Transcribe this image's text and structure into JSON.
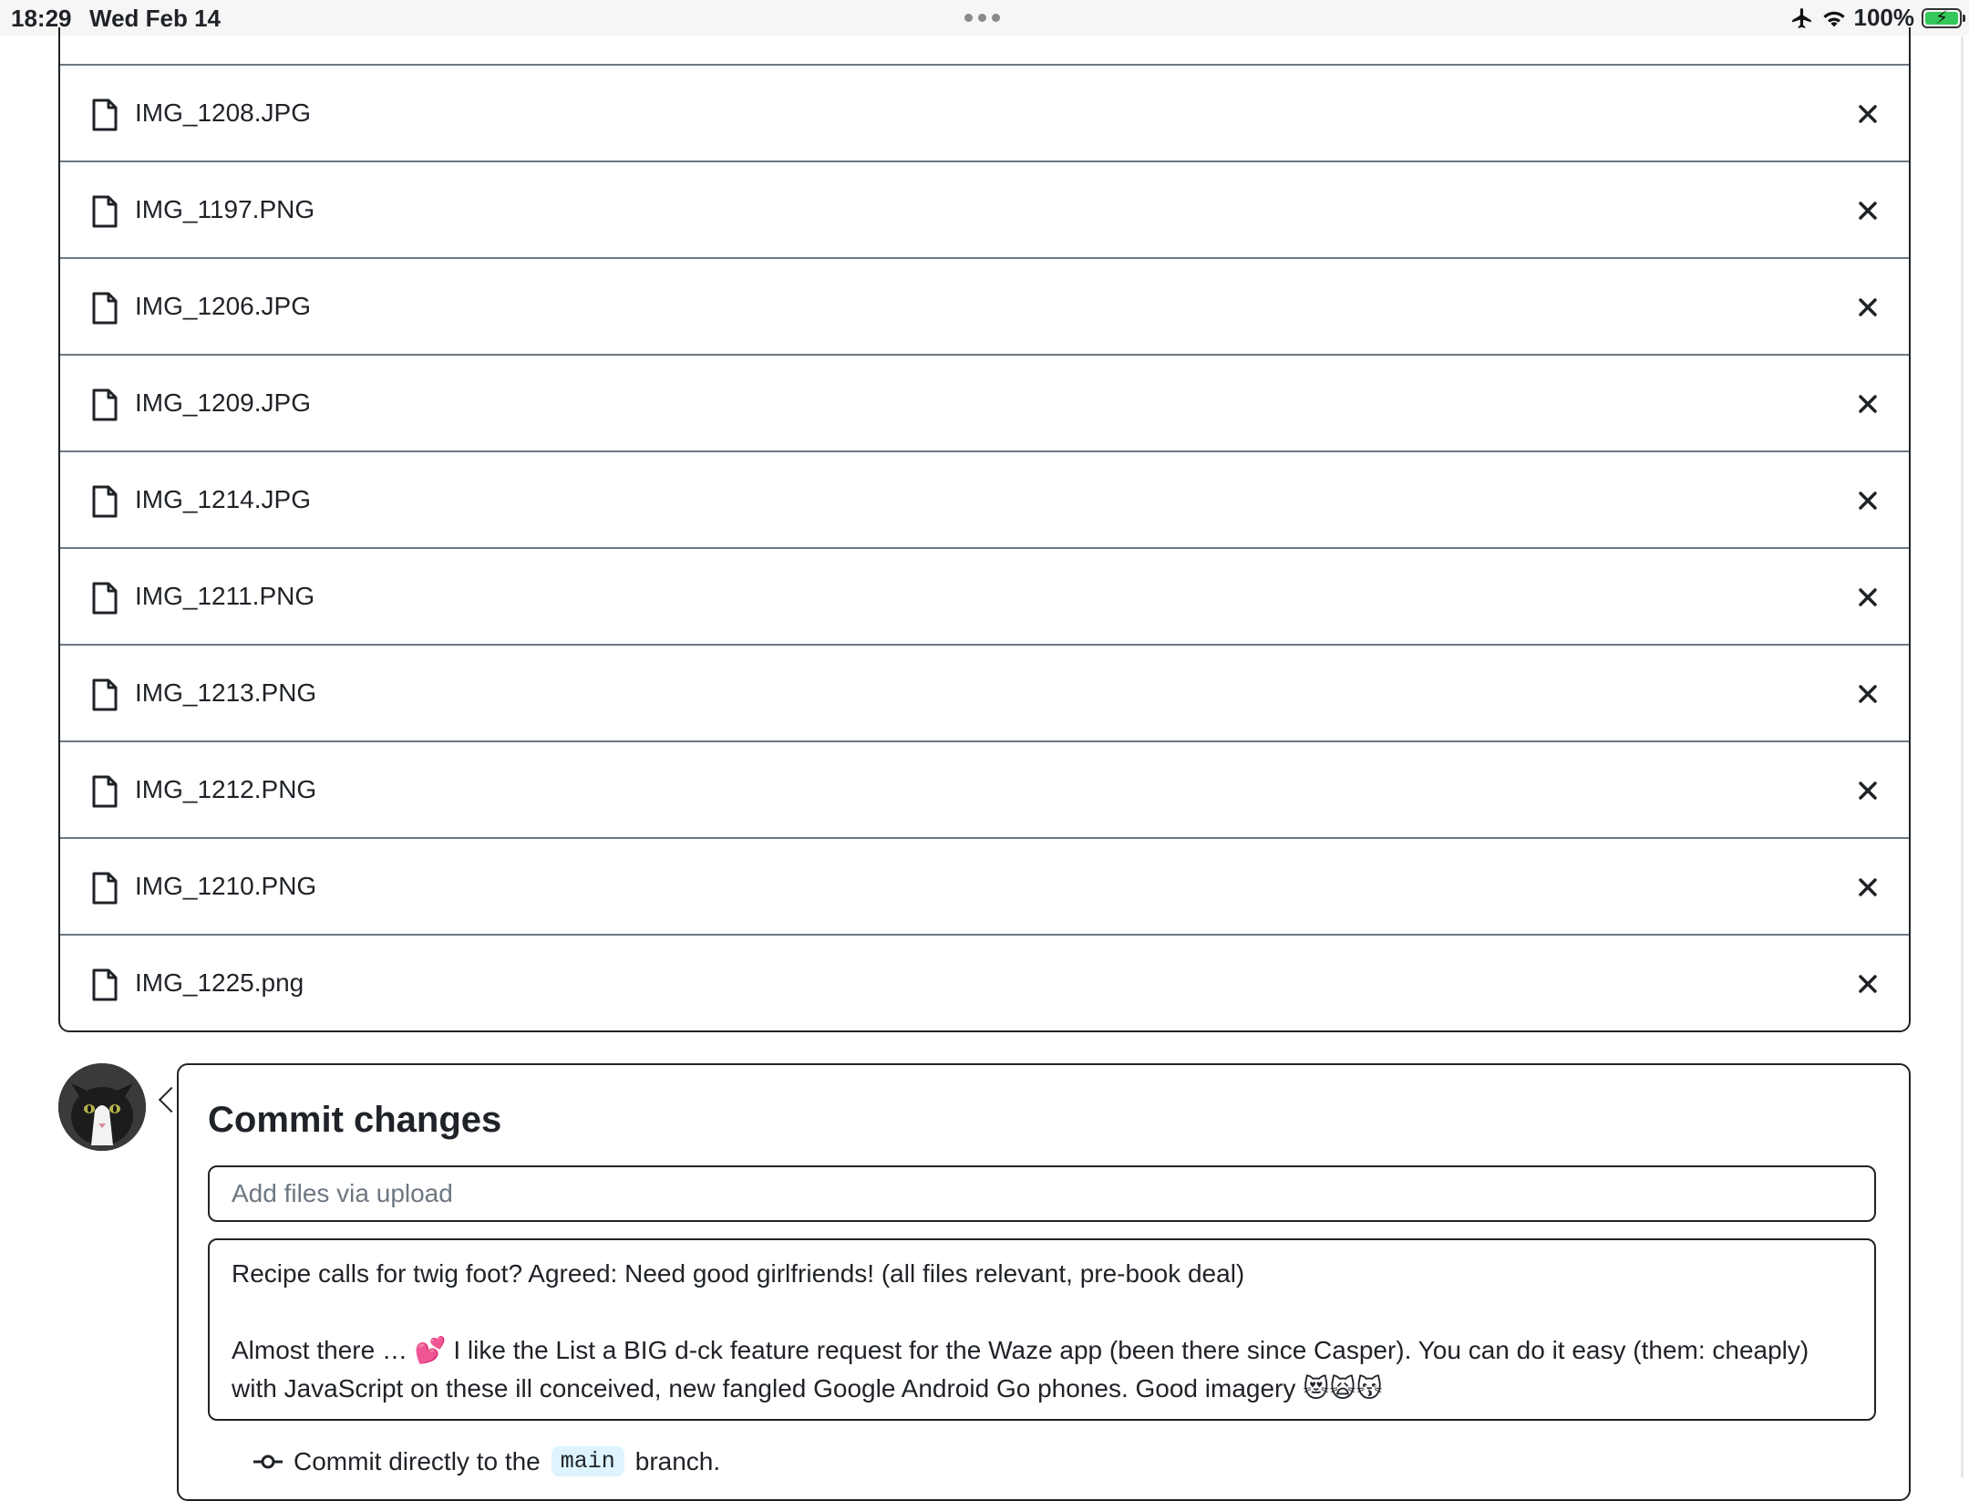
{
  "status_bar": {
    "time": "18:29",
    "date": "Wed Feb 14",
    "battery_text": "100%",
    "battery_level": 1.0,
    "icons": [
      "airplane-icon",
      "wifi-icon",
      "battery-icon"
    ]
  },
  "files": [
    {
      "name": "IMG_1208.JPG"
    },
    {
      "name": "IMG_1197.PNG"
    },
    {
      "name": "IMG_1206.JPG"
    },
    {
      "name": "IMG_1209.JPG"
    },
    {
      "name": "IMG_1214.JPG"
    },
    {
      "name": "IMG_1211.PNG"
    },
    {
      "name": "IMG_1213.PNG"
    },
    {
      "name": "IMG_1212.PNG"
    },
    {
      "name": "IMG_1210.PNG"
    },
    {
      "name": "IMG_1225.png"
    }
  ],
  "commit": {
    "title": "Commit changes",
    "summary_placeholder": "Add files via upload",
    "summary_value": "",
    "description": "Recipe calls for twig foot? Agreed: Need good girlfriends! (all files relevant, pre-book deal)\n\nAlmost there … 💕 I like the List a BIG d-ck feature request for the Waze app (been there since Casper). You can do it easy (them: cheaply) with JavaScript on these ill conceived, new fangled Google Android Go phones. Good imagery 😻🙀😽",
    "option_prefix": "Commit directly to the",
    "branch": "main",
    "option_suffix": "branch."
  }
}
